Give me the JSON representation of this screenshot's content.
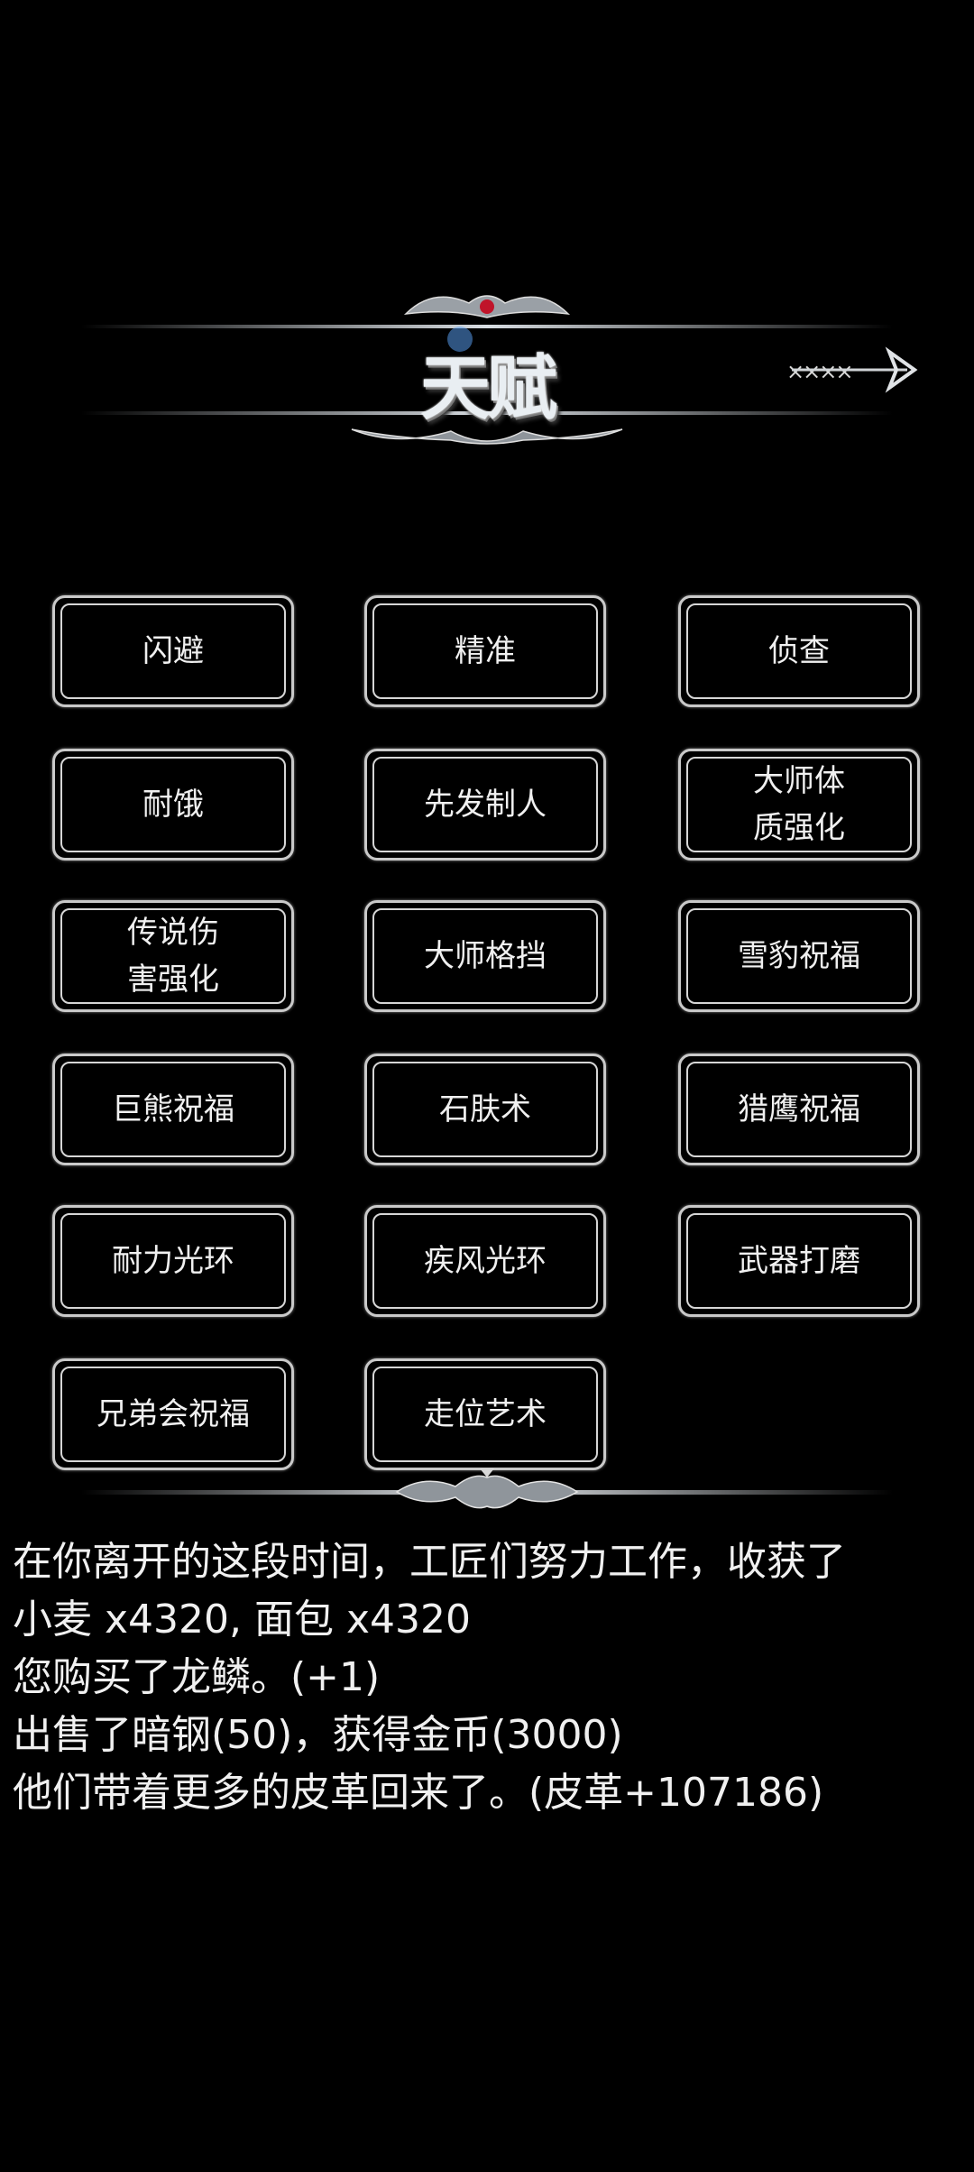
{
  "header": {
    "title": "天赋",
    "close_label": "××××"
  },
  "talents": [
    {
      "label": "闪避"
    },
    {
      "label": "精准"
    },
    {
      "label": "侦查"
    },
    {
      "label": "耐饿"
    },
    {
      "label": "先发制人"
    },
    {
      "label": "大师体\n质强化"
    },
    {
      "label": "传说伤\n害强化"
    },
    {
      "label": "大师格挡"
    },
    {
      "label": "雪豹祝福"
    },
    {
      "label": "巨熊祝福"
    },
    {
      "label": "石肤术"
    },
    {
      "label": "猎鹰祝福"
    },
    {
      "label": "耐力光环"
    },
    {
      "label": "疾风光环"
    },
    {
      "label": "武器打磨"
    },
    {
      "label": "兄弟会祝福"
    },
    {
      "label": "走位艺术"
    }
  ],
  "log": [
    "在你离开的这段时间，工匠们努力工作，收获了",
    "小麦 x4320, 面包 x4320",
    "您购买了龙鳞。(+1)",
    "出售了暗钢(50)，获得金币(3000)",
    "他们带着更多的皮革回来了。(皮革+107186)"
  ]
}
